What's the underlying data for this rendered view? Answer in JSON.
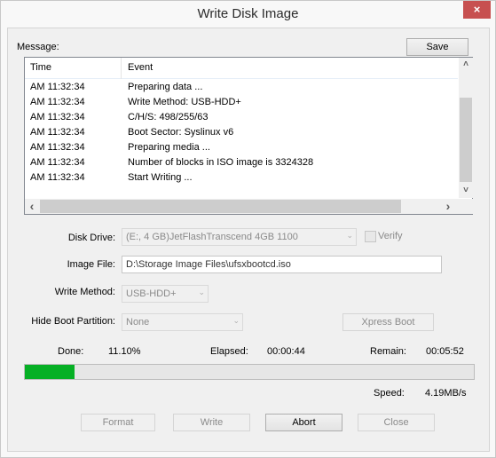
{
  "window": {
    "title": "Write Disk Image",
    "close_label": "×"
  },
  "message": {
    "label": "Message:",
    "save_label": "Save",
    "columns": [
      "Time",
      "Event"
    ],
    "rows": [
      {
        "time": "AM 11:32:34",
        "event": "Preparing data ..."
      },
      {
        "time": "AM 11:32:34",
        "event": "Write Method: USB-HDD+"
      },
      {
        "time": "AM 11:32:34",
        "event": "C/H/S: 498/255/63"
      },
      {
        "time": "AM 11:32:34",
        "event": "Boot Sector: Syslinux v6"
      },
      {
        "time": "AM 11:32:34",
        "event": "Preparing media ..."
      },
      {
        "time": "AM 11:32:34",
        "event": "Number of blocks in ISO image is 3324328"
      },
      {
        "time": "AM 11:32:34",
        "event": "Start Writing ..."
      }
    ],
    "scroll_up": "˄",
    "scroll_down": "˅",
    "scroll_left": "‹",
    "scroll_right": "›"
  },
  "form": {
    "disk_drive_label": "Disk Drive:",
    "disk_drive_value": "(E:, 4 GB)JetFlashTranscend 4GB   1100",
    "verify_label": "Verify",
    "verify_checked": false,
    "image_file_label": "Image File:",
    "image_file_value": "D:\\Storage Image Files\\ufsxbootcd.iso",
    "write_method_label": "Write Method:",
    "write_method_value": "USB-HDD+",
    "hide_boot_label": "Hide Boot Partition:",
    "hide_boot_value": "None",
    "xpress_boot_label": "Xpress Boot",
    "dropdown_glyph": "⌄"
  },
  "status": {
    "done_label": "Done:",
    "done_value": "11.10%",
    "progress_percent": 11.1,
    "elapsed_label": "Elapsed:",
    "elapsed_value": "00:00:44",
    "remain_label": "Remain:",
    "remain_value": "00:05:52",
    "speed_label": "Speed:",
    "speed_value": "4.19MB/s",
    "progress_color": "#06b025"
  },
  "buttons": {
    "format": "Format",
    "write": "Write",
    "abort": "Abort",
    "close": "Close"
  }
}
